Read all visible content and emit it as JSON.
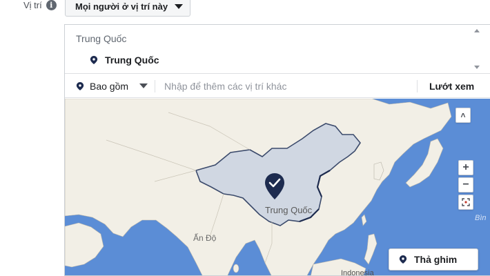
{
  "location": {
    "label": "Vị trí",
    "info_icon": "i",
    "audience_selector": "Mọi người ở vị trí này"
  },
  "selected_list": {
    "heading": "Trung Quốc",
    "items": [
      {
        "label": "Trung Quốc",
        "icon": "location-pin-icon"
      }
    ]
  },
  "filter": {
    "include_label": "Bao gồm",
    "input_placeholder": "Nhập để thêm các vị trí khác",
    "browse_label": "Lướt xem"
  },
  "map": {
    "labels": {
      "selected_country": "Trung Quốc",
      "india": "Ấn Độ",
      "indonesia": "Indonesia",
      "ocean_partial": "Bìn"
    },
    "controls": {
      "collapse": "˄",
      "zoom_in": "+",
      "zoom_out": "−",
      "fullscreen_icon": "fullscreen-icon"
    },
    "drop_pin_label": "Thả ghim",
    "colors": {
      "water": "#5b8dd6",
      "land": "#f2efe6",
      "selection_fill": "#cdd5e2",
      "selection_border": "#3b4a6b",
      "pin": "#1d2b4f"
    }
  }
}
